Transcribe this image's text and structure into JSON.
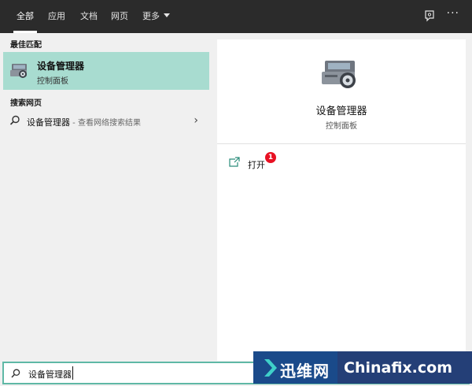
{
  "tabs": [
    {
      "label": "全部",
      "active": true
    },
    {
      "label": "应用",
      "active": false
    },
    {
      "label": "文档",
      "active": false
    },
    {
      "label": "网页",
      "active": false
    },
    {
      "label": "更多",
      "active": false,
      "has_dropdown": true
    }
  ],
  "toolbar_icons": [
    "feedback-icon",
    "more-options-icon"
  ],
  "more_options_label": "···",
  "left": {
    "best_match_heading": "最佳匹配",
    "best_match": {
      "title": "设备管理器",
      "subtitle": "控制面板",
      "icon": "device-manager-icon"
    },
    "web_heading": "搜索网页",
    "web_result": {
      "query": "设备管理器",
      "hint": " - 查看网络搜索结果",
      "icon": "search-icon"
    }
  },
  "right": {
    "title": "设备管理器",
    "subtitle": "控制面板",
    "actions": [
      {
        "label": "打开",
        "icon": "open-icon"
      }
    ],
    "badge": "1"
  },
  "search": {
    "value": "设备管理器"
  },
  "watermark": {
    "cn": "迅维网",
    "en": "Chinafix.com"
  },
  "colors": {
    "tabbar": "#2b2b2b",
    "selected": "#a8dcd0",
    "accent": "#5fb8a6",
    "badge": "#e81123"
  }
}
